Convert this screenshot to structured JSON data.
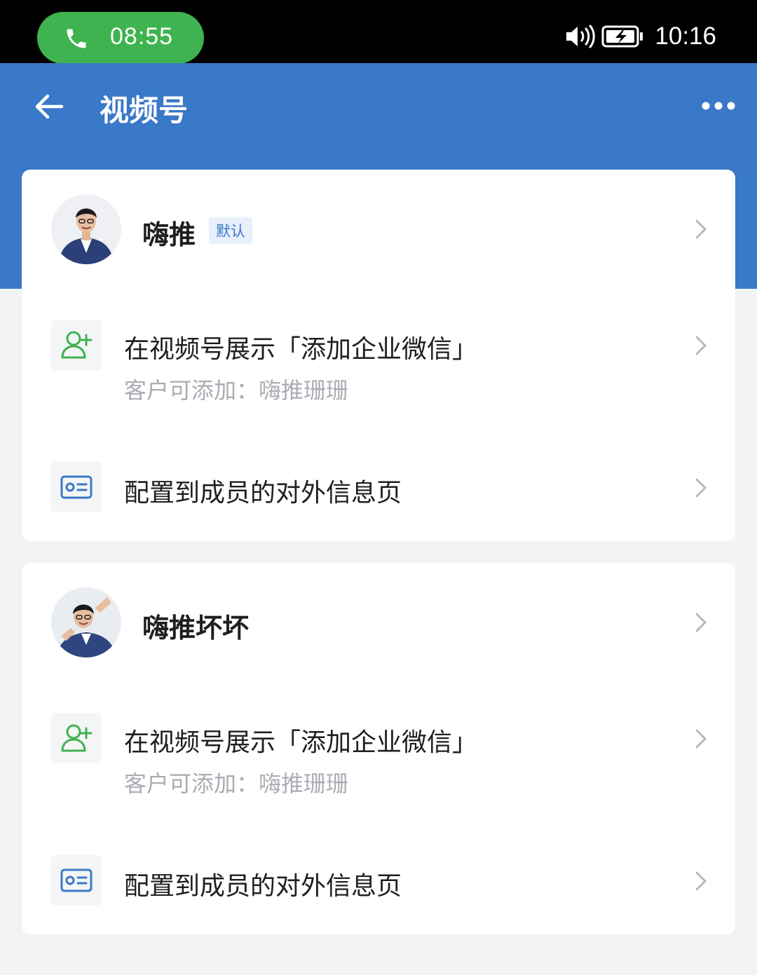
{
  "status_bar": {
    "call_time": "08:55",
    "clock": "10:16",
    "call_color": "#3fb34f"
  },
  "header": {
    "title": "视频号",
    "color": "#3a78c8"
  },
  "accounts": [
    {
      "name": "嗨推",
      "badge": "默认",
      "add_contact_title": "在视频号展示「添加企业微信」",
      "add_contact_sub": "客户可添加：嗨推珊珊",
      "profile_title": "配置到成员的对外信息页"
    },
    {
      "name": "嗨推坏坏",
      "add_contact_title": "在视频号展示「添加企业微信」",
      "add_contact_sub": "客户可添加：嗨推珊珊",
      "profile_title": "配置到成员的对外信息页"
    }
  ],
  "icons": {
    "call": "phone-icon",
    "volume": "volume-icon",
    "battery": "battery-charging-icon",
    "back": "arrow-left-icon",
    "more": "more-dots-icon",
    "add_contact": "add-user-icon",
    "profile": "id-card-icon",
    "chevron": "chevron-right-icon"
  }
}
